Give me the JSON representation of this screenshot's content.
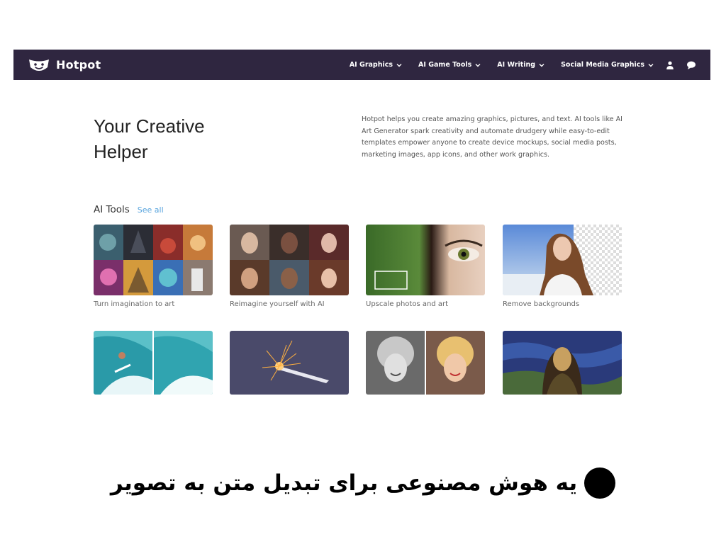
{
  "navbar": {
    "brand": "Hotpot",
    "menu": [
      {
        "label": "AI Graphics"
      },
      {
        "label": "AI Game Tools"
      },
      {
        "label": "AI Writing"
      },
      {
        "label": "Social Media Graphics"
      }
    ],
    "icons": [
      "user-icon",
      "chat-bubble-icon"
    ],
    "background_color": "#2f2640"
  },
  "hero": {
    "title_line1": "Your Creative",
    "title_line2": "Helper",
    "description": "Hotpot helps you create amazing graphics, pictures, and text. AI tools like AI Art Generator spark creativity and automate drudgery while easy-to-edit templates empower anyone to create device mockups, social media posts, marketing images, app icons, and other work graphics."
  },
  "ai_tools": {
    "title": "AI Tools",
    "see_all": "See all",
    "see_all_color": "#56a3dd",
    "cards": [
      {
        "label": "Turn imagination to art"
      },
      {
        "label": "Reimagine yourself with AI"
      },
      {
        "label": "Upscale photos and art"
      },
      {
        "label": "Remove backgrounds"
      },
      {
        "label": ""
      },
      {
        "label": ""
      },
      {
        "label": ""
      },
      {
        "label": ""
      }
    ]
  },
  "caption": {
    "text": "یه هوش مصنوعی برای تبدیل متن به تصویر"
  }
}
